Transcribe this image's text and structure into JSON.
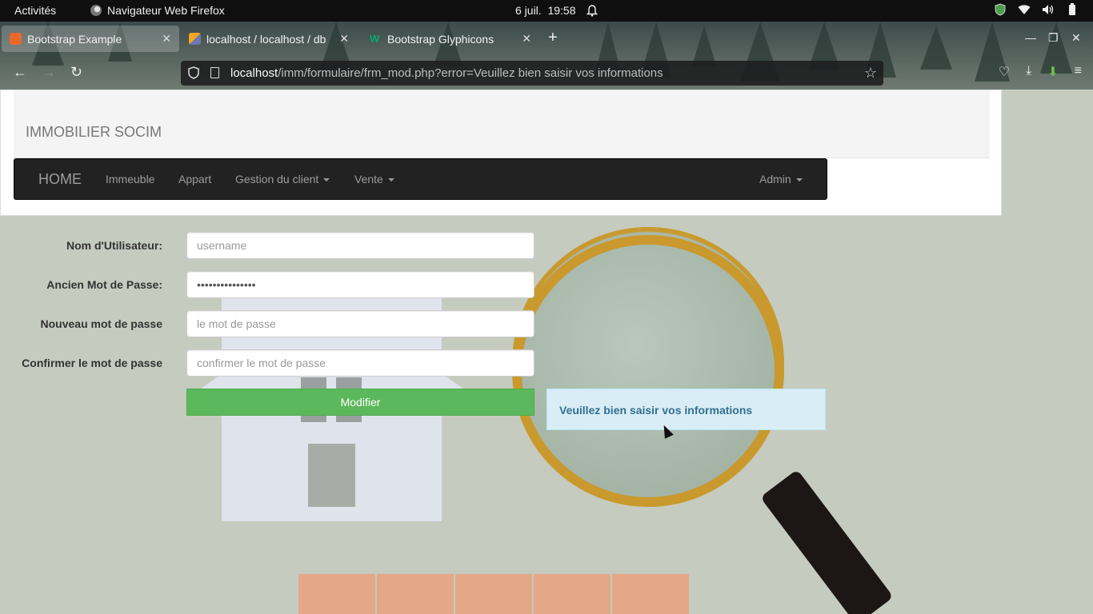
{
  "system_bar": {
    "activities": "Activités",
    "app_name": "Navigateur Web Firefox",
    "date": "6 juil.",
    "time": "19:58"
  },
  "browser": {
    "tabs": [
      {
        "label": "Bootstrap Example",
        "active": true,
        "favicon": "xampp-icon"
      },
      {
        "label": "localhost / localhost / db",
        "active": false,
        "favicon": "phpmyadmin-icon"
      },
      {
        "label": "Bootstrap Glyphicons",
        "active": false,
        "favicon": "w3schools-icon"
      }
    ],
    "url_host": "localhost",
    "url_path": "/imm/formulaire/frm_mod.php?error=Veuillez bien saisir vos informations"
  },
  "page": {
    "brand": "IMMOBILIER SOCIM",
    "nav": {
      "home": "HOME",
      "items": [
        "Immeuble",
        "Appart",
        "Gestion du client",
        "Vente"
      ],
      "admin": "Admin"
    },
    "form": {
      "username_label": "Nom d'Utilisateur:",
      "username_placeholder": "username",
      "old_password_label": "Ancien Mot de Passe:",
      "old_password_value": "•••••••••••••••",
      "new_password_label": "Nouveau mot de passe",
      "new_password_placeholder": "le mot de passe",
      "confirm_label": "Confirmer le mot de passe",
      "confirm_placeholder": "confirmer le mot de passe",
      "submit": "Modifier"
    },
    "alert": "Veuillez bien saisir vos informations"
  },
  "colors": {
    "navbar_bg": "#222222",
    "button_green": "#5cb85c",
    "alert_bg": "#d9edf7",
    "alert_text": "#31708f"
  }
}
